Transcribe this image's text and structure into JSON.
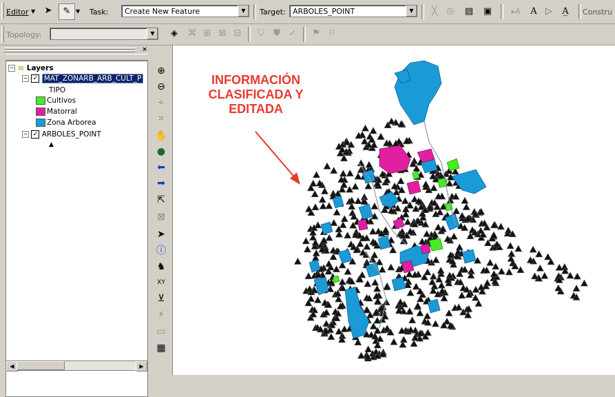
{
  "editor_toolbar": {
    "editor_label": "Editor",
    "task_label": "Task:",
    "task_value": "Create New Feature",
    "target_label": "Target:",
    "target_value": "ARBOLES_POINT",
    "construct_label": "Constru"
  },
  "topology_toolbar": {
    "topology_label": "Topology:",
    "topology_value": ""
  },
  "toc": {
    "root_label": "Layers",
    "layer1_name": "MAT_ZONARB_ARB_CULT_P",
    "layer1_field": "TIPO",
    "legend": [
      {
        "label": "Cultivos",
        "color": "#44ee22"
      },
      {
        "label": "Matorral",
        "color": "#e020a0"
      },
      {
        "label": "Zona Arborea",
        "color": "#1a9ad6"
      }
    ],
    "layer2_name": "ARBOLES_POINT"
  },
  "map": {
    "annotation_lines": [
      "INFORMACIÓN",
      "CLASIFICADA Y",
      "EDITADA"
    ],
    "annotation_color": "#e83a2e",
    "colors": {
      "zona_arborea": "#1a9ad6",
      "matorral": "#e020a0",
      "cultivos": "#44ee22",
      "trees": "#111111"
    }
  }
}
